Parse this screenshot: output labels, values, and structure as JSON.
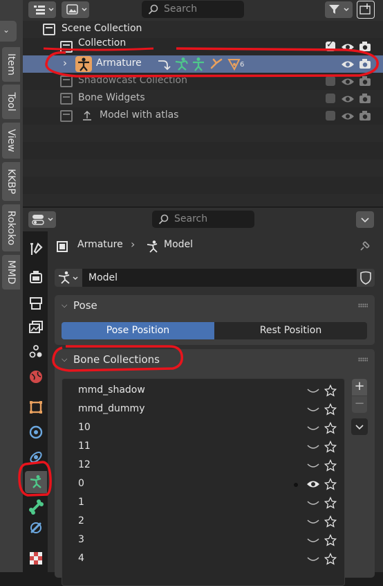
{
  "viewport_tabs": [
    {
      "label": "Item"
    },
    {
      "label": "Tool"
    },
    {
      "label": "View"
    },
    {
      "label": "KKBP"
    },
    {
      "label": "Rokoko"
    },
    {
      "label": "MMD"
    }
  ],
  "outliner": {
    "search_placeholder": "Search",
    "rows": [
      {
        "label": "Scene Collection"
      },
      {
        "label": "Collection"
      },
      {
        "label": "Armature"
      },
      {
        "label": "Shadowcast Collection"
      },
      {
        "label": "Bone Widgets"
      },
      {
        "label": "Model with atlas"
      }
    ],
    "selected_row": "Armature",
    "armature_child_count": "6"
  },
  "properties": {
    "search_placeholder": "Search",
    "breadcrumb": {
      "object": "Armature",
      "data": "Model"
    },
    "data_name_value": "Model",
    "pose_panel": {
      "title": "Pose",
      "options": [
        "Pose Position",
        "Rest Position"
      ],
      "selected": "Pose Position"
    },
    "bone_collections_panel": {
      "title": "Bone Collections",
      "items": [
        {
          "name": "mmd_shadow",
          "visible": false,
          "active": false
        },
        {
          "name": "mmd_dummy",
          "visible": false,
          "active": false
        },
        {
          "name": "10",
          "visible": false,
          "active": false
        },
        {
          "name": "11",
          "visible": false,
          "active": false
        },
        {
          "name": "12",
          "visible": false,
          "active": false
        },
        {
          "name": "0",
          "visible": true,
          "active": true
        },
        {
          "name": "1",
          "visible": false,
          "active": false
        },
        {
          "name": "2",
          "visible": false,
          "active": false
        },
        {
          "name": "3",
          "visible": false,
          "active": false
        },
        {
          "name": "4",
          "visible": false,
          "active": false
        }
      ],
      "add_label": "+",
      "remove_label": "−"
    }
  },
  "colors": {
    "selection": "#5a6f99",
    "accent_blue": "#4772b3",
    "armature_icon": "#e8a05e",
    "bone_green": "#4ec98a",
    "annotation_red": "#e8141c"
  }
}
